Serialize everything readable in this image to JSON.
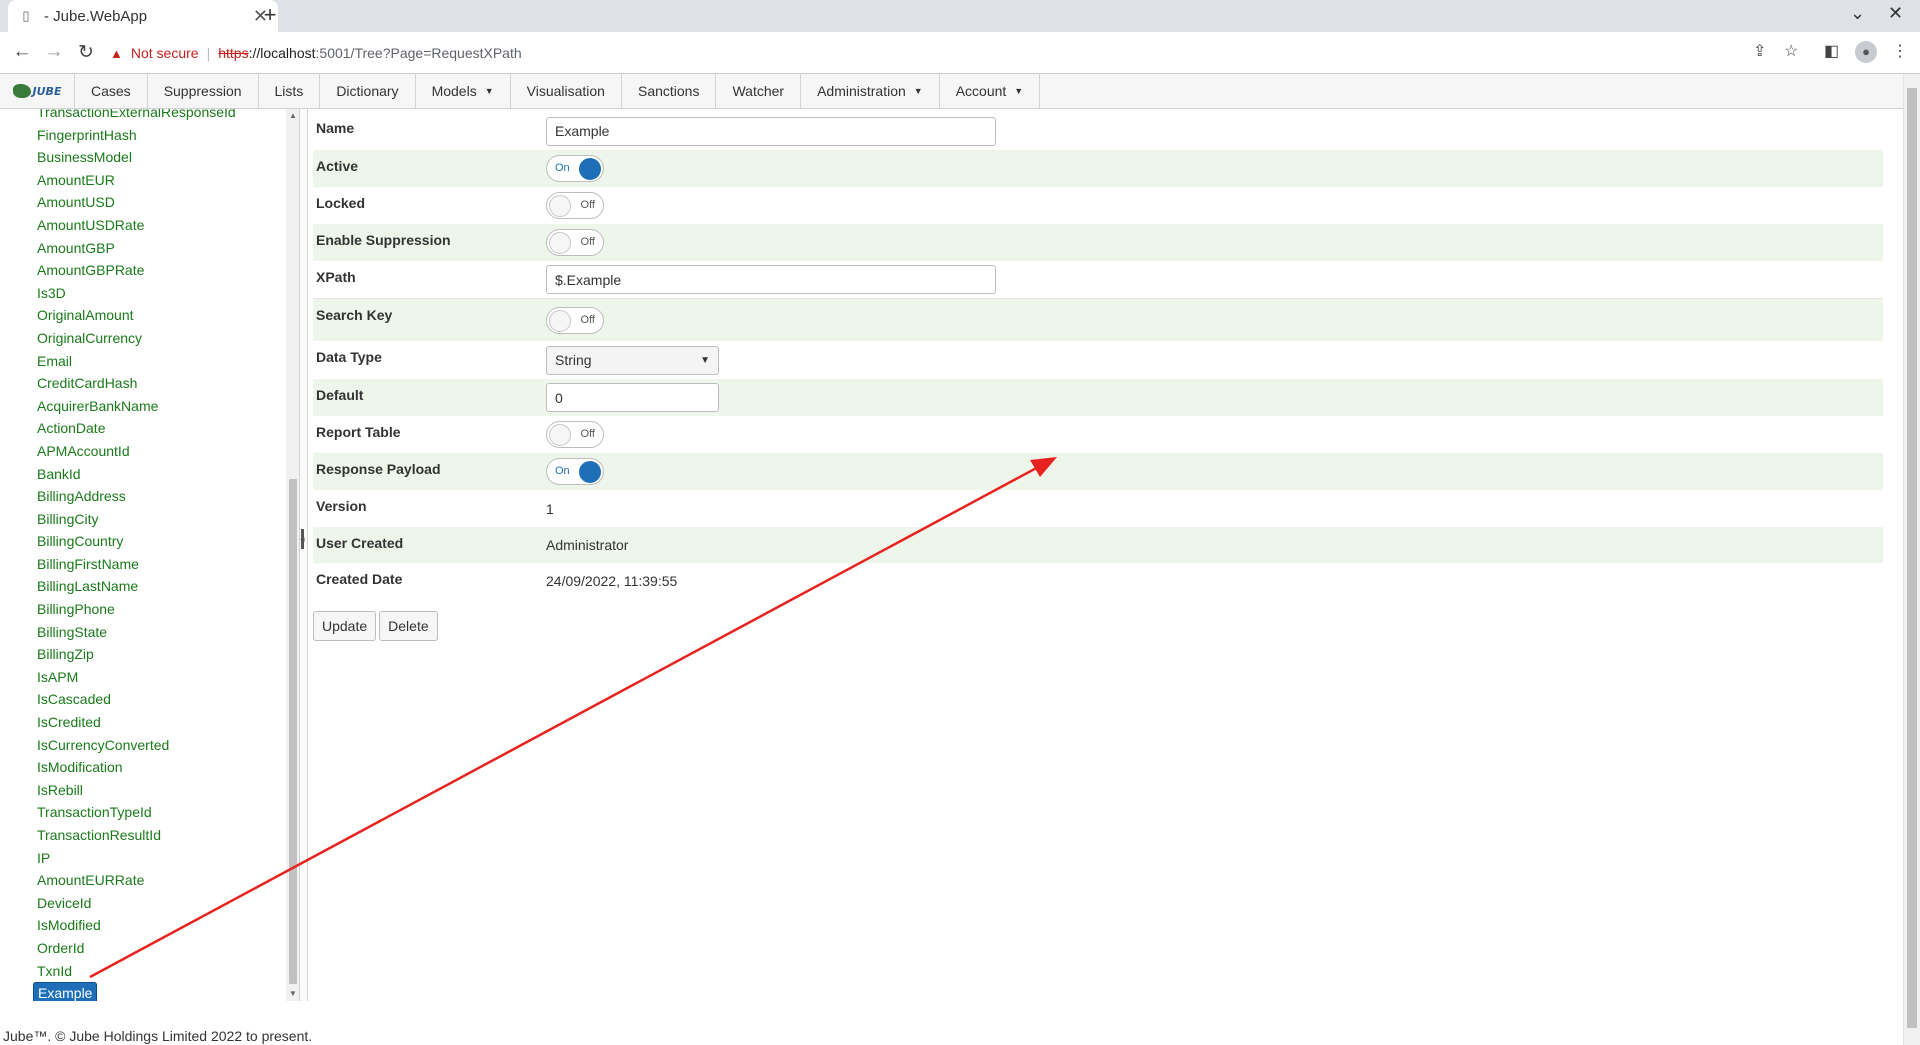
{
  "browser": {
    "tab_title": "- Jube.WebApp",
    "new_tab": "+",
    "not_secure": "Not secure",
    "url_scheme": "https",
    "url_host": "://localhost",
    "url_path": ":5001/Tree?Page=RequestXPath"
  },
  "menu": {
    "logo_text": "JUBE",
    "items": [
      {
        "label": "Cases"
      },
      {
        "label": "Suppression"
      },
      {
        "label": "Lists"
      },
      {
        "label": "Dictionary"
      },
      {
        "label": "Models",
        "dropdown": true
      },
      {
        "label": "Visualisation"
      },
      {
        "label": "Sanctions"
      },
      {
        "label": "Watcher"
      },
      {
        "label": "Administration",
        "dropdown": true
      },
      {
        "label": "Account",
        "dropdown": true
      }
    ]
  },
  "tree": {
    "items": [
      "TransactionExternalResponseId",
      "FingerprintHash",
      "BusinessModel",
      "AmountEUR",
      "AmountUSD",
      "AmountUSDRate",
      "AmountGBP",
      "AmountGBPRate",
      "Is3D",
      "OriginalAmount",
      "OriginalCurrency",
      "Email",
      "CreditCardHash",
      "AcquirerBankName",
      "ActionDate",
      "APMAccountId",
      "BankId",
      "BillingAddress",
      "BillingCity",
      "BillingCountry",
      "BillingFirstName",
      "BillingLastName",
      "BillingPhone",
      "BillingState",
      "BillingZip",
      "IsAPM",
      "IsCascaded",
      "IsCredited",
      "IsCurrencyConverted",
      "IsModification",
      "IsRebill",
      "TransactionTypeId",
      "TransactionResultId",
      "IP",
      "AmountEURRate",
      "DeviceId",
      "IsModified",
      "OrderId",
      "TxnId",
      "Example"
    ],
    "selected": "Example"
  },
  "form": {
    "name": {
      "label": "Name",
      "value": "Example"
    },
    "active": {
      "label": "Active",
      "state": "On"
    },
    "locked": {
      "label": "Locked",
      "state": "Off"
    },
    "enable_suppression": {
      "label": "Enable Suppression",
      "state": "Off"
    },
    "xpath": {
      "label": "XPath",
      "value": "$.Example"
    },
    "search_key": {
      "label": "Search Key",
      "state": "Off"
    },
    "data_type": {
      "label": "Data Type",
      "value": "String"
    },
    "default": {
      "label": "Default",
      "value": "0"
    },
    "report_table": {
      "label": "Report Table",
      "state": "Off"
    },
    "response_payload": {
      "label": "Response Payload",
      "state": "On"
    },
    "version": {
      "label": "Version",
      "value": "1"
    },
    "user_created": {
      "label": "User Created",
      "value": "Administrator"
    },
    "created_date": {
      "label": "Created Date",
      "value": "24/09/2022, 11:39:55"
    },
    "update_label": "Update",
    "delete_label": "Delete"
  },
  "footer": "Jube™. © Jube Holdings Limited 2022 to present.",
  "colors": {
    "accent": "#1e6fb8",
    "tree_text": "#1a7a1a",
    "stripe": "#eef5ea",
    "annotation_arrow": "#e8231f"
  }
}
